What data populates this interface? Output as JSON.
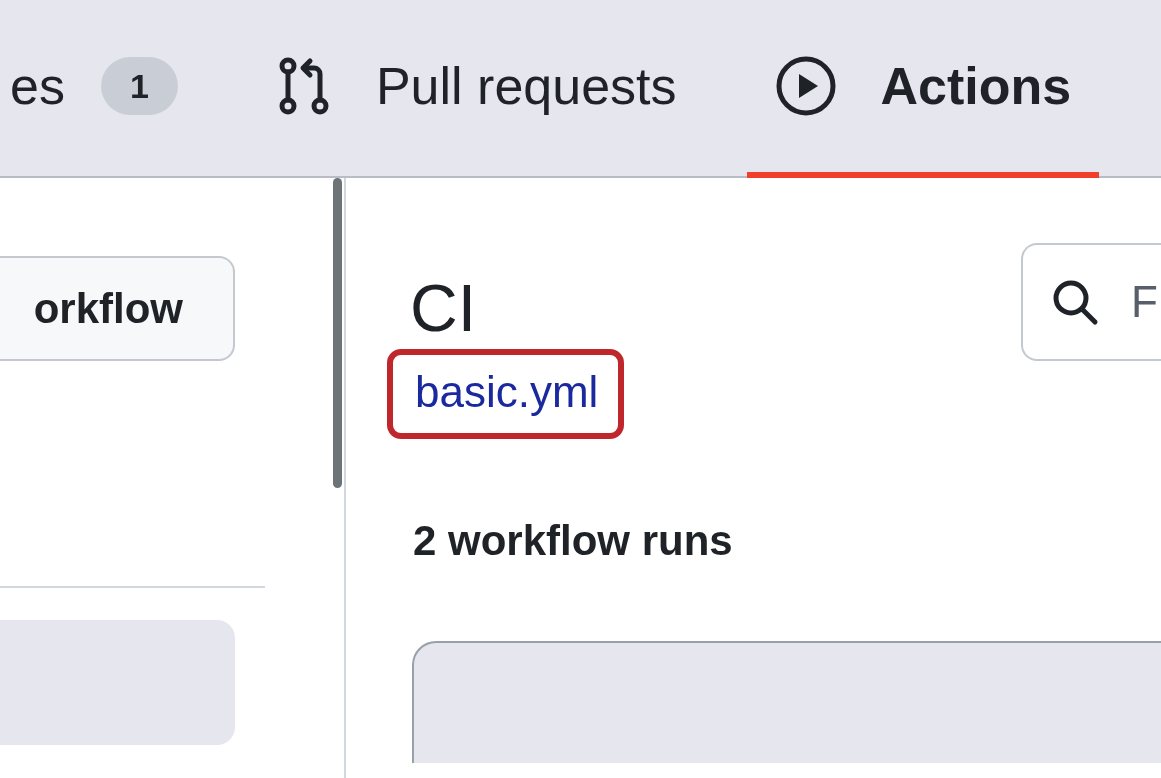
{
  "tabs": [
    {
      "label": "es",
      "badge": "1",
      "selected": false
    },
    {
      "label": "Pull requests",
      "kind": "pull-request",
      "selected": false
    },
    {
      "label": "Actions",
      "kind": "play",
      "selected": true
    }
  ],
  "sidebar": {
    "button": "orkflow"
  },
  "workflow": {
    "title": "CI",
    "file_link": "basic.yml",
    "file_link_highlighted": true,
    "search": {
      "placeholder": "F"
    },
    "runs_count": "2 workflow runs"
  }
}
